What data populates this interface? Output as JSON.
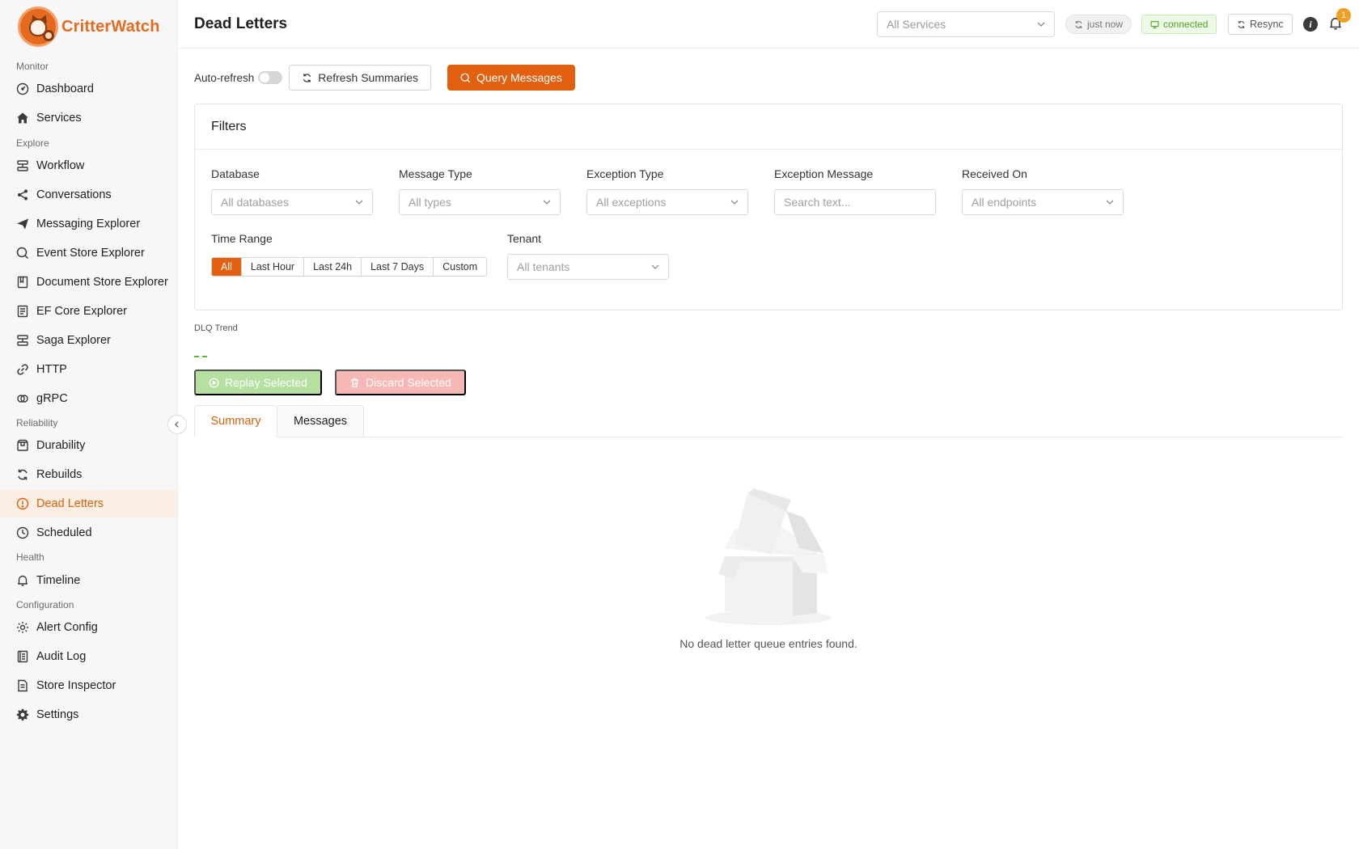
{
  "app": {
    "name": "CritterWatch"
  },
  "sidebar": {
    "sections": {
      "monitor": "Monitor",
      "explore": "Explore",
      "reliability": "Reliability",
      "health": "Health",
      "configuration": "Configuration"
    },
    "items": {
      "dashboard": "Dashboard",
      "services": "Services",
      "workflow": "Workflow",
      "conversations": "Conversations",
      "messaging_explorer": "Messaging Explorer",
      "event_store_explorer": "Event Store Explorer",
      "document_store_explorer": "Document Store Explorer",
      "ef_core_explorer": "EF Core Explorer",
      "saga_explorer": "Saga Explorer",
      "http": "HTTP",
      "grpc": "gRPC",
      "durability": "Durability",
      "rebuilds": "Rebuilds",
      "dead_letters": "Dead Letters",
      "scheduled": "Scheduled",
      "timeline": "Timeline",
      "alert_config": "Alert Config",
      "audit_log": "Audit Log",
      "store_inspector": "Store Inspector",
      "settings": "Settings"
    },
    "active": "dead_letters"
  },
  "header": {
    "title": "Dead Letters",
    "service_select": "All Services",
    "last_update": "just now",
    "connection": "connected",
    "resync": "Resync",
    "notifications_count": "1"
  },
  "toolbar": {
    "auto_refresh": "Auto-refresh",
    "auto_refresh_on": false,
    "refresh_summaries": "Refresh Summaries",
    "query_messages": "Query Messages"
  },
  "filters": {
    "title": "Filters",
    "database": {
      "label": "Database",
      "value": "All databases"
    },
    "message_type": {
      "label": "Message Type",
      "value": "All types"
    },
    "exception_type": {
      "label": "Exception Type",
      "value": "All exceptions"
    },
    "exception_message": {
      "label": "Exception Message",
      "placeholder": "Search text..."
    },
    "received_on": {
      "label": "Received On",
      "value": "All endpoints"
    },
    "time_range": {
      "label": "Time Range",
      "options": [
        "All",
        "Last Hour",
        "Last 24h",
        "Last 7 Days",
        "Custom"
      ],
      "selected": "All"
    },
    "tenant": {
      "label": "Tenant",
      "value": "All tenants"
    }
  },
  "trend": {
    "label": "DLQ Trend"
  },
  "actions": {
    "replay": "Replay Selected",
    "discard": "Discard Selected"
  },
  "tabs": {
    "summary": "Summary",
    "messages": "Messages",
    "active": "summary"
  },
  "empty_state": {
    "text": "No dead letter queue entries found."
  },
  "colors": {
    "accent": "#e2600f",
    "success": "#52b829",
    "danger": "#f7b7b5"
  }
}
